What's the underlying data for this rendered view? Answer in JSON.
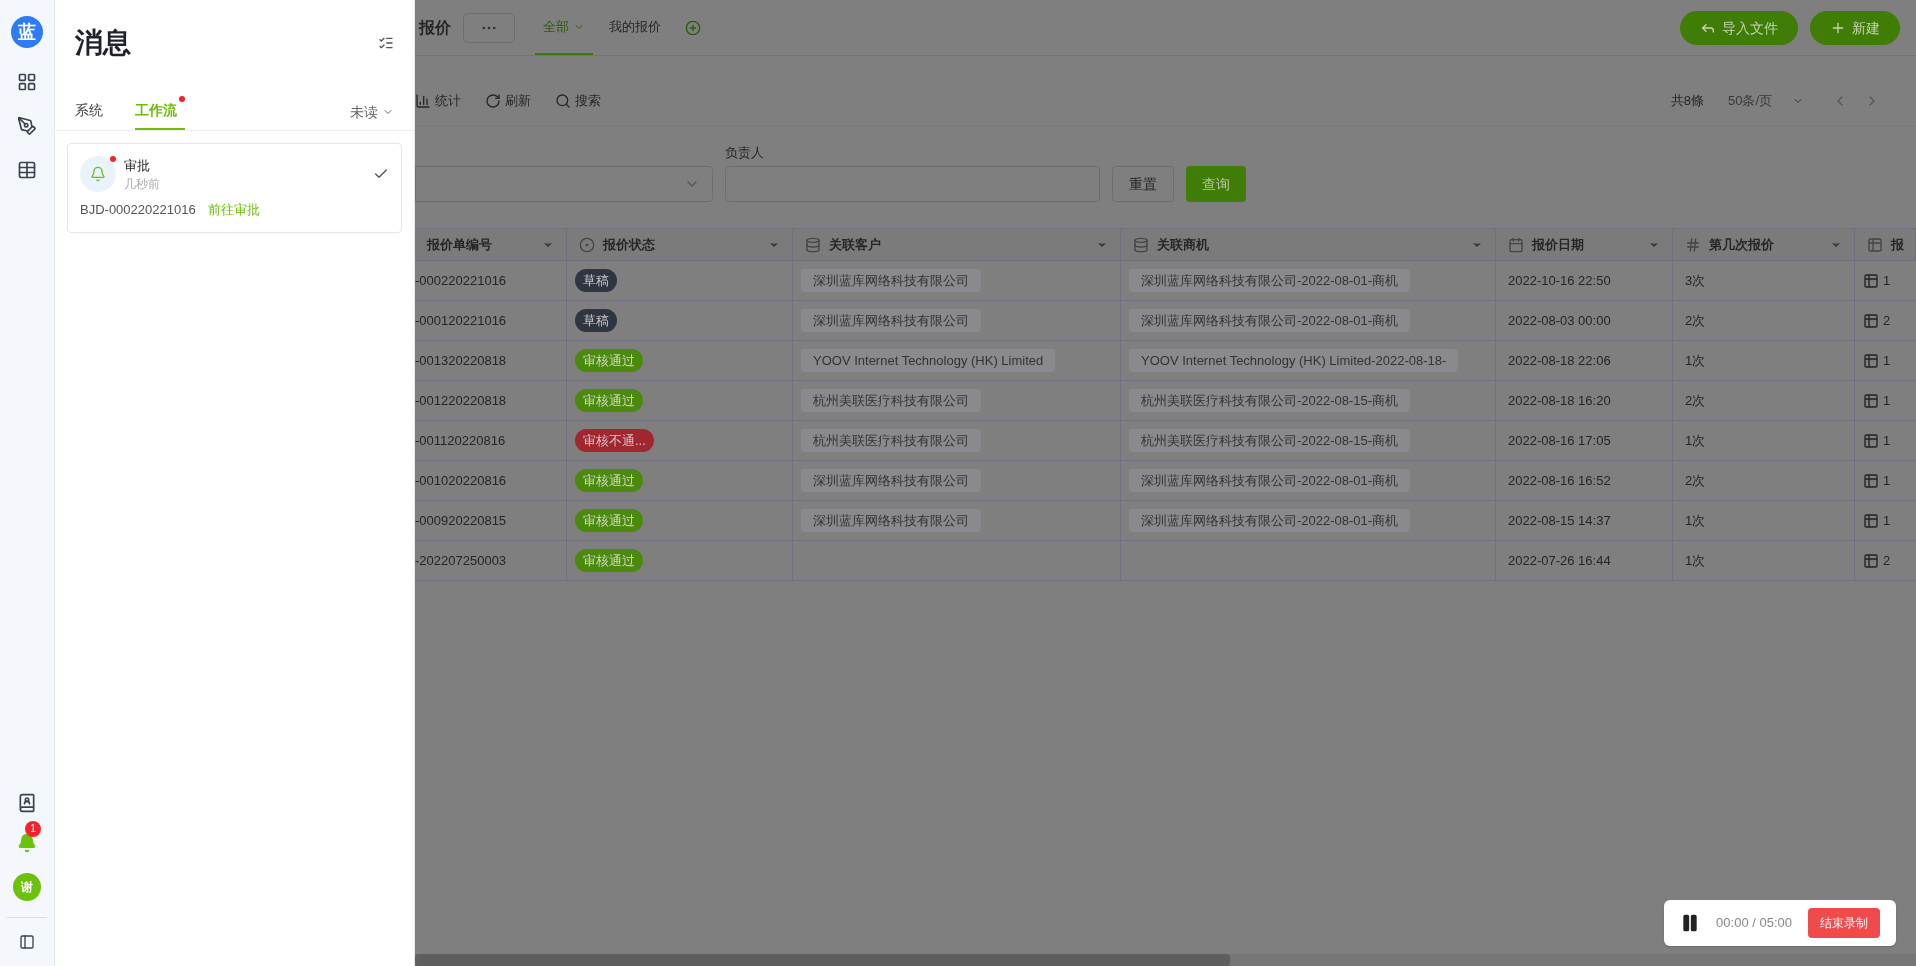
{
  "rail": {
    "logo": "蓝",
    "notification_badge": "1",
    "avatar": "谢"
  },
  "messages": {
    "title": "消息",
    "tabs": [
      {
        "label": "系统",
        "selected": false,
        "unread_dot": false
      },
      {
        "label": "工作流",
        "selected": true,
        "unread_dot": true
      }
    ],
    "filter": "未读",
    "items": [
      {
        "title": "审批",
        "time": "几秒前",
        "unread": true,
        "code": "BJD-000220221016",
        "link": "前往审批"
      }
    ]
  },
  "page": {
    "title": "报价",
    "tabs": [
      {
        "label": "全部",
        "selected": true
      },
      {
        "label": "我的报价",
        "selected": false
      }
    ],
    "buttons": [
      {
        "label": "导入文件",
        "kind": "import"
      },
      {
        "label": "新建",
        "kind": "new"
      }
    ]
  },
  "toolbar": {
    "actions": [
      {
        "label": "统计",
        "kind": "stats"
      },
      {
        "label": "刷新",
        "kind": "refresh"
      },
      {
        "label": "搜索",
        "kind": "search"
      }
    ],
    "total": "共8條",
    "page_size": "50条/页"
  },
  "filters": {
    "owner_label": "负责人",
    "buttons": [
      {
        "label": "重置",
        "kind": "reset"
      },
      {
        "label": "查询",
        "kind": "query"
      }
    ]
  },
  "table": {
    "columns": [
      {
        "label": "报价单编号",
        "kind": "text"
      },
      {
        "label": "报价状态",
        "kind": "status"
      },
      {
        "label": "关联客户",
        "kind": "link"
      },
      {
        "label": "关联商机",
        "kind": "link"
      },
      {
        "label": "报价日期",
        "kind": "date"
      },
      {
        "label": "第几次报价",
        "kind": "number"
      },
      {
        "label": "报",
        "kind": "table"
      }
    ],
    "rows": [
      {
        "number": "-000220221016",
        "status": {
          "label": "草稿",
          "kind": "draft"
        },
        "customer": "深圳蓝库网络科技有限公司",
        "opportunity": "深圳蓝库网络科技有限公司-2022-08-01-商机",
        "date": "2022-10-16 22:50",
        "round": "3次",
        "column_7": "1"
      },
      {
        "number": "-000120221016",
        "status": {
          "label": "草稿",
          "kind": "draft"
        },
        "customer": "深圳蓝库网络科技有限公司",
        "opportunity": "深圳蓝库网络科技有限公司-2022-08-01-商机",
        "date": "2022-08-03 00:00",
        "round": "2次",
        "column_7": "2"
      },
      {
        "number": "-001320220818",
        "status": {
          "label": "审核通过",
          "kind": "approved"
        },
        "customer": "YOOV Internet Technology (HK) Limited",
        "opportunity": "YOOV Internet Technology (HK) Limited-2022-08-18-",
        "date": "2022-08-18 22:06",
        "round": "1次",
        "column_7": "1"
      },
      {
        "number": "-001220220818",
        "status": {
          "label": "审核通过",
          "kind": "approved"
        },
        "customer": "杭州美联医疗科技有限公司",
        "opportunity": "杭州美联医疗科技有限公司-2022-08-15-商机",
        "date": "2022-08-18 16:20",
        "round": "2次",
        "column_7": "1"
      },
      {
        "number": "-001120220816",
        "status": {
          "label": "审核不通...",
          "kind": "rejected"
        },
        "customer": "杭州美联医疗科技有限公司",
        "opportunity": "杭州美联医疗科技有限公司-2022-08-15-商机",
        "date": "2022-08-16 17:05",
        "round": "1次",
        "column_7": "1"
      },
      {
        "number": "-001020220816",
        "status": {
          "label": "审核通过",
          "kind": "approved"
        },
        "customer": "深圳蓝库网络科技有限公司",
        "opportunity": "深圳蓝库网络科技有限公司-2022-08-01-商机",
        "date": "2022-08-16 16:52",
        "round": "2次",
        "column_7": "1"
      },
      {
        "number": "-000920220815",
        "status": {
          "label": "审核通过",
          "kind": "approved"
        },
        "customer": "深圳蓝库网络科技有限公司",
        "opportunity": "深圳蓝库网络科技有限公司-2022-08-01-商机",
        "date": "2022-08-15 14:37",
        "round": "1次",
        "column_7": "1"
      },
      {
        "number": "-202207250003",
        "status": {
          "label": "审核通过",
          "kind": "approved"
        },
        "date": "2022-07-26 16:44",
        "round": "1次",
        "column_7": "2"
      }
    ]
  },
  "recording": {
    "time": "00:00 / 05:00",
    "button": "结束录制"
  }
}
